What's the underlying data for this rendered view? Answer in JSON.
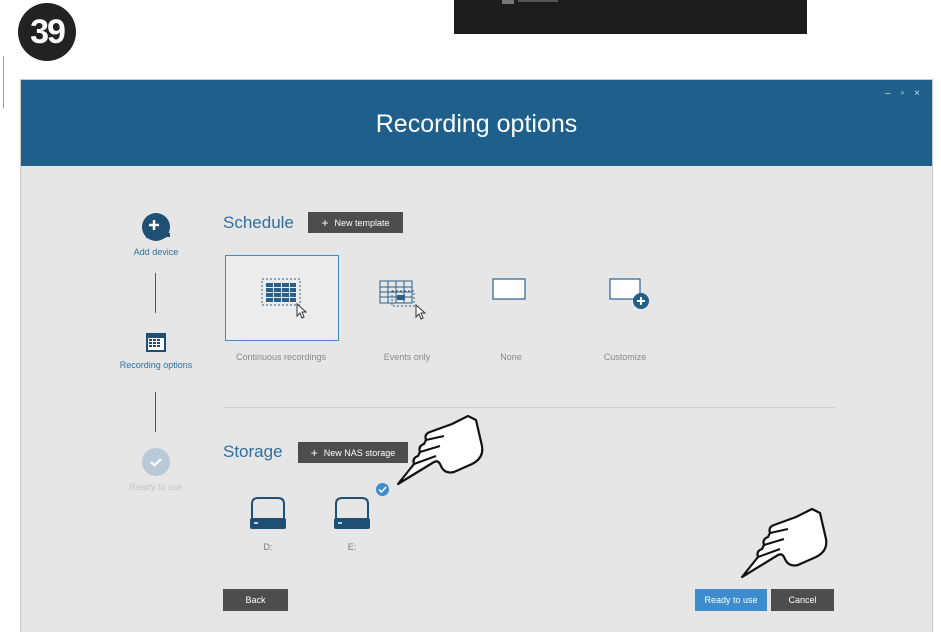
{
  "step_badge": "39",
  "window": {
    "title": "Recording options",
    "controls": [
      "–",
      "▫",
      "×"
    ]
  },
  "stepper": {
    "steps": [
      {
        "label": "Add device",
        "icon": "add-device-icon"
      },
      {
        "label": "Recording options",
        "icon": "calendar-icon"
      },
      {
        "label": "Ready to use",
        "icon": "check-icon"
      }
    ]
  },
  "schedule": {
    "title": "Schedule",
    "new_template_label": "New template",
    "options": [
      {
        "label": "Continuous recordings",
        "selected": true
      },
      {
        "label": "Events only",
        "selected": false
      },
      {
        "label": "None",
        "selected": false
      },
      {
        "label": "Customize",
        "selected": false
      }
    ]
  },
  "storage": {
    "title": "Storage",
    "new_nas_label": "New NAS storage",
    "drives": [
      {
        "label": "D:",
        "selected": false
      },
      {
        "label": "E:",
        "selected": true
      }
    ]
  },
  "footer": {
    "back_label": "Back",
    "ready_label": "Ready to use",
    "cancel_label": "Cancel"
  },
  "colors": {
    "title_bar": "#1f5f8b",
    "accent": "#3d8ccd",
    "dark_button": "#4d4d4d"
  }
}
